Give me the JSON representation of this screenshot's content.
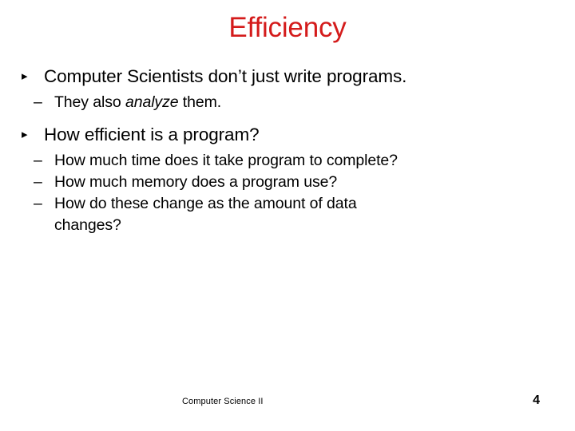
{
  "slide": {
    "title": "Efficiency",
    "title_color": "#d41b1b",
    "background_color": "#ffffff",
    "text_color": "#000000",
    "bullet_marker_l1": "▸",
    "bullet_marker_l2": "–",
    "content": [
      {
        "level": 1,
        "text": "Computer Scientists don’t just write programs."
      },
      {
        "level": 2,
        "text_before_emphasis": "They also ",
        "emphasis": "analyze",
        "text_after_emphasis": " them."
      },
      {
        "level": 1,
        "text": "How efficient is a program?"
      },
      {
        "level": 2,
        "text": "How much time does it take program to complete?"
      },
      {
        "level": 2,
        "text": "How much memory does a program use?"
      },
      {
        "level": 2,
        "line1": "How do these change as the amount of data",
        "line2": "changes?"
      }
    ]
  },
  "footer": {
    "label": "Computer Science II",
    "page_number": "4"
  }
}
